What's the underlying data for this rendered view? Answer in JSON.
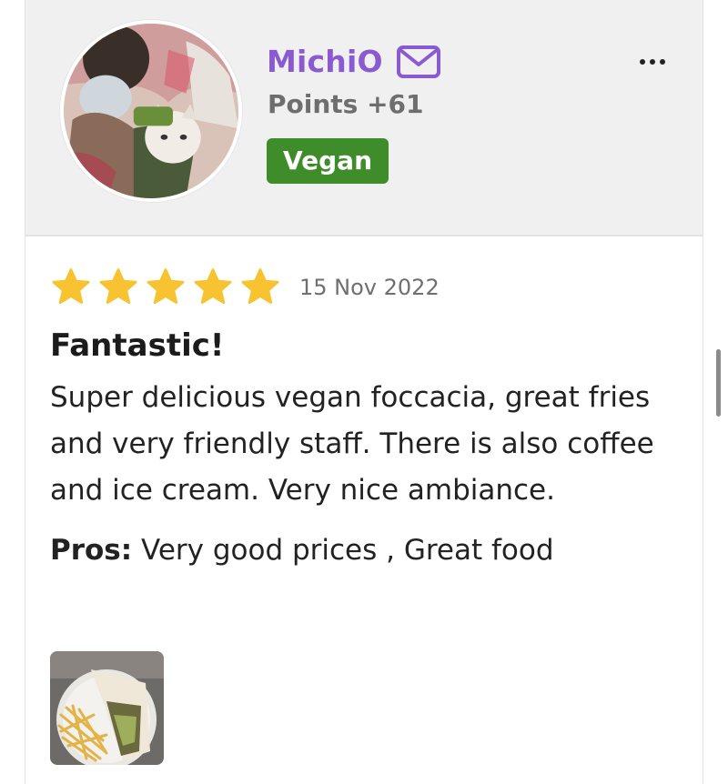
{
  "user": {
    "name": "MichiO",
    "points": "Points +61",
    "badge": "Vegan",
    "avatar_icon": "user-avatar-photo",
    "message_icon": "mail-icon",
    "more_icon": "more-dots-icon",
    "name_color": "#8a5ad1",
    "badge_color": "#3f8d2a"
  },
  "review": {
    "rating": 5,
    "rating_max": 5,
    "date": "15 Nov 2022",
    "title": "Fantastic!",
    "body": "Super delicious vegan foccacia, great fries and very friendly staff. There is also coffee and ice cream. Very nice ambiance.",
    "pros_label": "Pros:",
    "pros": "Very good prices , Great food",
    "star_color": "#f7c331"
  },
  "photos": [
    {
      "icon": "food-photo-thumbnail"
    }
  ]
}
